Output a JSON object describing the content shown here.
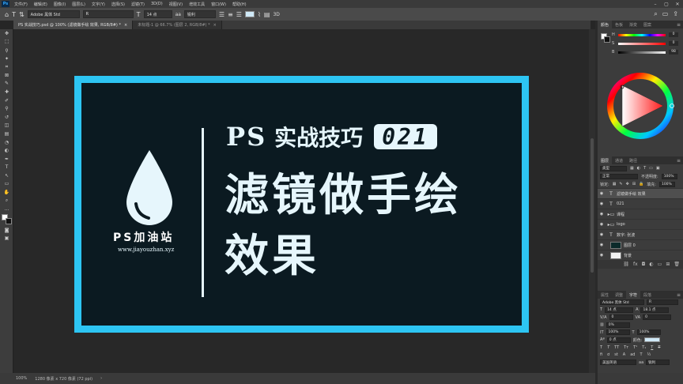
{
  "menubar": {
    "items": [
      "文件(F)",
      "编辑(E)",
      "图像(I)",
      "图层(L)",
      "文字(Y)",
      "选择(S)",
      "滤镜(T)",
      "3D(D)",
      "视图(V)",
      "增效工具",
      "窗口(W)",
      "帮助(H)"
    ],
    "app_icon": "Ps"
  },
  "options": {
    "tool_icon": "T",
    "font_family": "Adobe 黑体 Std",
    "font_style": "R",
    "size_icon": "T",
    "font_size": "14 点",
    "aa_label": "aa",
    "antialias": "锐利",
    "text_color": "#cfe9f7",
    "right_icons": [
      "search-icon",
      "workspace-icon",
      "share-icon"
    ]
  },
  "tabs": [
    {
      "label": "PS 实战技巧.psd @ 100% (滤镜做手绘 效果, RGB/8#) *",
      "active": true
    },
    {
      "label": "未标题-1 @ 66.7% (图层 2, RGB/8#) *",
      "active": false
    }
  ],
  "toolbar": {
    "tools": [
      "move-icon",
      "marquee-icon",
      "lasso-icon",
      "magic-wand-icon",
      "crop-icon",
      "frame-icon",
      "eyedropper-icon",
      "healing-icon",
      "brush-icon",
      "stamp-icon",
      "history-brush-icon",
      "eraser-icon",
      "gradient-icon",
      "blur-icon",
      "dodge-icon",
      "pen-icon",
      "type-icon",
      "path-select-icon",
      "shape-icon",
      "hand-icon",
      "zoom-icon",
      "more-icon"
    ],
    "glyphs": [
      "✥",
      "⬚",
      "ϙ",
      "✦",
      "⌗",
      "⊠",
      "✎",
      "✚",
      "✐",
      "⚲",
      "↺",
      "◫",
      "▤",
      "◔",
      "◐",
      "✒",
      "T",
      "↖",
      "▭",
      "✋",
      "⌕",
      "…"
    ]
  },
  "artboard": {
    "border_color": "#2dc5f3",
    "bg_color": "#0b1a21",
    "logo_name": "PS加油站",
    "logo_url": "www.jiayouzhan.xyz",
    "title_ps": "PS",
    "title_cn": "实战技巧",
    "badge": "021",
    "headline_1": "滤镜做手绘",
    "headline_2": "效果"
  },
  "panels": {
    "color_tabs": [
      "颜色",
      "色板",
      "渐变",
      "图案"
    ],
    "color_channels": [
      {
        "label": "H",
        "value": "0"
      },
      {
        "label": "S",
        "value": "0"
      },
      {
        "label": "B",
        "value": "98"
      }
    ],
    "layers_tabs": [
      "图层",
      "通道",
      "路径"
    ],
    "filter_kind": "类型",
    "blend_mode": "正常",
    "opacity_label": "不透明度:",
    "opacity": "100%",
    "lock_label": "锁定:",
    "fill_label": "填充:",
    "fill": "100%",
    "layers": [
      {
        "kind": "T",
        "name": "滤镜做手绘 效果",
        "selected": true,
        "thumb": ""
      },
      {
        "kind": "T",
        "name": "021",
        "selected": false,
        "thumb": ""
      },
      {
        "kind": "folder",
        "name": "课程",
        "selected": false,
        "thumb": ""
      },
      {
        "kind": "folder",
        "name": "logo",
        "selected": false,
        "thumb": ""
      },
      {
        "kind": "T",
        "name": "数字: 张波",
        "selected": false,
        "thumb": ""
      },
      {
        "kind": "img",
        "name": "图层 0",
        "selected": false,
        "thumb": "#0b2a2a"
      },
      {
        "kind": "img",
        "name": "背景",
        "selected": false,
        "thumb": "#f2f2f2"
      }
    ],
    "char_tabs": [
      "属性",
      "调整",
      "字符",
      "段落"
    ],
    "char_font": "Adobe 黑体 Std",
    "char_style": "R",
    "char_size": "14 点",
    "char_leading": "18.1 点",
    "char_kerning": "0",
    "char_tracking": "0",
    "char_scale_v": "0%",
    "char_scale_h1": "100%",
    "char_scale_h2": "100%",
    "char_baseline": "0 点",
    "char_color_label": "颜色:",
    "char_lang": "美国英语",
    "char_aa": "锐利"
  },
  "status": {
    "zoom": "100%",
    "doc_info": "1280 像素 x 720 像素 (72 ppi)"
  }
}
